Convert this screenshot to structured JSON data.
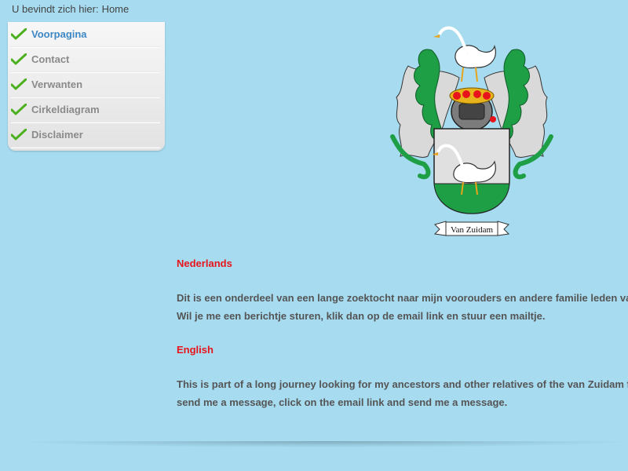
{
  "breadcrumb": {
    "prefix": "U bevindt zich hier:",
    "current": "Home"
  },
  "menu": {
    "items": [
      {
        "label": "Voorpagina",
        "active": true
      },
      {
        "label": "Contact",
        "active": false
      },
      {
        "label": "Verwanten",
        "active": false
      },
      {
        "label": "Cirkeldiagram",
        "active": false
      },
      {
        "label": "Disclaimer",
        "active": false
      }
    ],
    "check_color": "#4caf1e",
    "active_color": "#3d87c5"
  },
  "crest": {
    "banner_text": "Van Zuidam",
    "icon": "coat-of-arms-swan"
  },
  "content": {
    "nl_heading": "Nederlands",
    "nl_line1": "Dit is een onderdeel van een lange zoektocht naar mijn voorouders en andere familie leden va",
    "nl_line2": "Wil je me een berichtje sturen, klik dan op de email link en stuur een mailtje.",
    "en_heading": "English",
    "en_line1": "This is part of a long journey looking for my ancestors and other relatives of the van Zuidam f",
    "en_line2": "send me a message, click on the email link and send me a message.",
    "heading_color": "#e8141b",
    "text_color": "#555555"
  },
  "colors": {
    "background": "#a6dbf0"
  }
}
